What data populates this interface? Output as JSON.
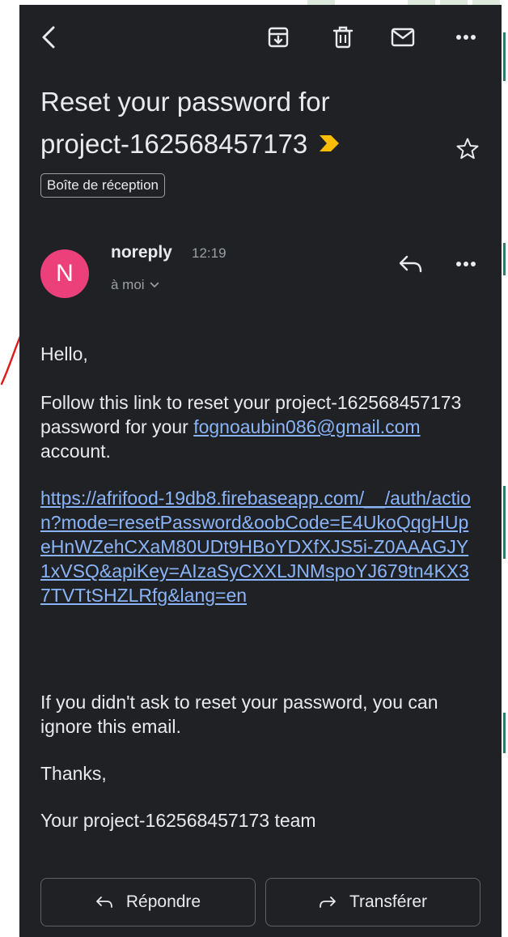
{
  "toolbar": {
    "back_icon": "chevron-left-icon",
    "archive_icon": "archive-icon",
    "delete_icon": "trash-icon",
    "mark_unread_icon": "mail-icon",
    "more_icon": "more-horizontal-icon"
  },
  "email": {
    "subject_line1": "Reset your password for",
    "subject_line2": "project-162568457173",
    "label": "Boîte de réception",
    "sender_initial": "N",
    "sender": "noreply",
    "time": "12:19",
    "to": "à moi",
    "body": {
      "greeting": "Hello,",
      "para1_before": "Follow this link to reset your project-162568457173 password for your",
      "para1_email": "fognoaubin086@gmail.com",
      "para1_after": " account.",
      "reset_link": "https://afrifood-19db8.firebaseapp.com/__/auth/action?mode=resetPassword&oobCode=E4UkoQqgHUpeHnWZehCXaM80UDt9HBoYDXfXJS5i-Z0AAAGJY1xVSQ&apiKey=AIzaSyCXXLJNMspoYJ679tn4KX37TVTtSHZLRfg&lang=en",
      "para3": "If you didn't ask to reset your password, you can ignore this email.",
      "thanks": "Thanks,",
      "signature": "Your project-162568457173 team"
    }
  },
  "actions": {
    "reply_label": "Répondre",
    "forward_label": "Transférer"
  },
  "colors": {
    "background": "#202124",
    "text": "#e8eaed",
    "link": "#8ab4f8",
    "avatar": "#ec407a",
    "importance": "#fbbc04",
    "annotation": "#e01818"
  }
}
